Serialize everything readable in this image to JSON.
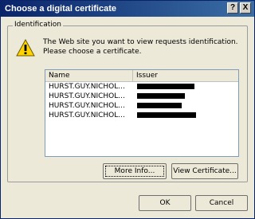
{
  "window": {
    "title": "Choose a digital certificate",
    "help_label": "?",
    "close_label": "X"
  },
  "group": {
    "label": "Identification",
    "icon": "warning-icon",
    "message": "The Web site you want to view requests identification. Please choose a certificate."
  },
  "table": {
    "columns": [
      "Name",
      "Issuer"
    ],
    "rows": [
      {
        "name": "HURST.GUY.NICHOL...",
        "issuer_redacted": true
      },
      {
        "name": "HURST.GUY.NICHOL...",
        "issuer_redacted": true
      },
      {
        "name": "HURST.GUY.NICHOL...",
        "issuer_redacted": true
      },
      {
        "name": "HURST.GUY.NICHOL...",
        "issuer_redacted": true
      }
    ]
  },
  "buttons": {
    "more_info": "More Info...",
    "view_certificate": "View Certificate...",
    "ok": "OK",
    "cancel": "Cancel"
  },
  "colors": {
    "titlebar_start": "#0a246a",
    "titlebar_end": "#3a6ea5",
    "dialog_face": "#ece9d8",
    "warning_yellow": "#ffd400"
  }
}
